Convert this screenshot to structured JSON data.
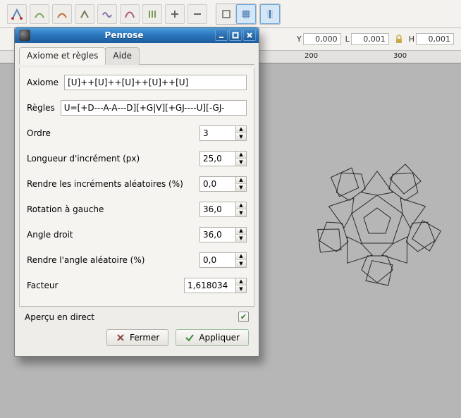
{
  "window": {
    "title": "Penrose"
  },
  "statusbar": {
    "y_label": "Y",
    "y_value": "0,000",
    "l_label": "L",
    "l_value": "0,001",
    "h_label": "H",
    "h_value": "0,001"
  },
  "ruler": {
    "tick_a": "200",
    "tick_b": "300"
  },
  "tabs": {
    "axiom_rules": "Axiome et règles",
    "help": "Aide"
  },
  "fields": {
    "axiom_label": "Axiome",
    "axiom_value": "[U]++[U]++[U]++[U]++[U]",
    "rules_label": "Règles",
    "rules_value": "U=[+D---A-A---D][+G|V][+GJ----U][-GJ-",
    "order_label": "Ordre",
    "order_value": "3",
    "increment_label": "Longueur d'incrément (px)",
    "increment_value": "25,0",
    "rand_increments_label": "Rendre les incréments aléatoires (%)",
    "rand_increments_value": "0,0",
    "left_rotation_label": "Rotation à gauche",
    "left_rotation_value": "36,0",
    "right_angle_label": "Angle droit",
    "right_angle_value": "36,0",
    "rand_angle_label": "Rendre l'angle aléatoire (%)",
    "rand_angle_value": "0,0",
    "factor_label": "Facteur",
    "factor_value": "1,618034"
  },
  "footer": {
    "live_preview": "Aperçu en direct",
    "live_preview_checked": true
  },
  "buttons": {
    "close": "Fermer",
    "apply": "Appliquer"
  }
}
